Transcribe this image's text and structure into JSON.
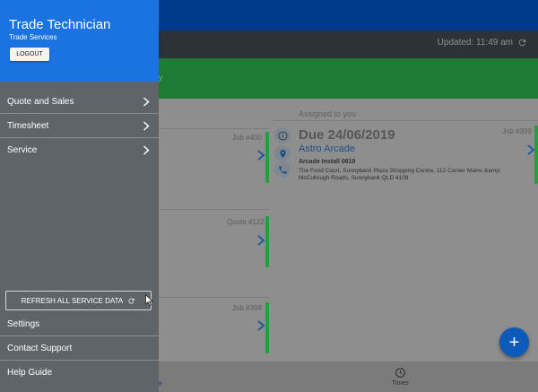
{
  "status": {
    "updated_text": "Updated: 11:49 am"
  },
  "green_banner": {
    "partial_text": "y"
  },
  "assigned_header": "Assigned to you",
  "cards_left": [
    {
      "number": "Job #400"
    },
    {
      "number": "Quote #122"
    },
    {
      "number": "Job #398"
    }
  ],
  "assigned_card": {
    "number": "Job #399",
    "due": "Due 24/06/2019",
    "site": "Astro Arcade",
    "job_title": "Arcade Install 0619",
    "address": "The Food Court, Sunnybank Plaza Shopping Centre, 112 Corner Mains &amp; McCullough Roads, Sunnybank QLD 4109"
  },
  "tabbar": {
    "times_label": "Times",
    "left_partial": "e"
  },
  "fab": {
    "label": "+"
  },
  "drawer": {
    "title": "Trade Technician",
    "subtitle": "Trade Services",
    "logout_label": "LOGOUT",
    "menu": [
      {
        "label": "Quote and Sales"
      },
      {
        "label": "Timesheet"
      },
      {
        "label": "Service"
      }
    ],
    "refresh_label": "REFRESH ALL SERVICE DATA",
    "bottom_items": [
      {
        "label": "Settings"
      },
      {
        "label": "Contact Support"
      },
      {
        "label": "Help Guide"
      }
    ]
  },
  "colors": {
    "drawer_header": "#1a73e0",
    "drawer_body": "#5e6468",
    "status_green": "#2e9b3e",
    "fab_blue": "#0d5ab8"
  }
}
